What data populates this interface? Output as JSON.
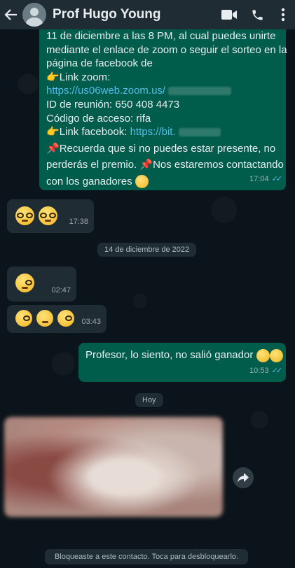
{
  "header": {
    "title": "Prof Hugo Young",
    "back_icon": "arrow-left-icon",
    "video_icon": "video-call-icon",
    "call_icon": "phone-icon",
    "menu_icon": "more-vert-icon"
  },
  "messages": {
    "m1": {
      "line_partial": "11 de diciembre a las 8 PM, al cual puedes unirte",
      "line2": "mediante el enlace de zoom o seguir el sorteo en la",
      "line3": "página de facebook de",
      "zoom_label": "Link zoom:",
      "zoom_url": "https://us06web.zoom.us/",
      "meeting_id": "ID de reunión: 650 408 4473",
      "access_code": "Código de acceso: rifa",
      "fb_label": "Link facebook:",
      "fb_url": "https://bit.",
      "reminder_1": "Recuerda que si no puedes estar presente, no",
      "reminder_2": "perderás el premio.",
      "reminder_3": "Nos estaremos contactando",
      "reminder_4": "con los ganadores",
      "time": "17:04"
    },
    "m2": {
      "time": "17:38"
    },
    "date_chip": "14 de diciembre de 2022",
    "m3": {
      "time": "02:47"
    },
    "m4": {
      "time": "03:43"
    },
    "m5": {
      "text": "Profesor, lo siento, no salió ganador",
      "time": "10:53"
    },
    "today_chip": "Hoy"
  },
  "footer": {
    "text": "Bloqueaste a este contacto. Toca para desbloquearlo."
  },
  "colors": {
    "header": "#1f2c34",
    "outgoing": "#005c4b",
    "incoming": "#1f2c34",
    "link": "#53bdeb",
    "background": "#0b141a"
  }
}
